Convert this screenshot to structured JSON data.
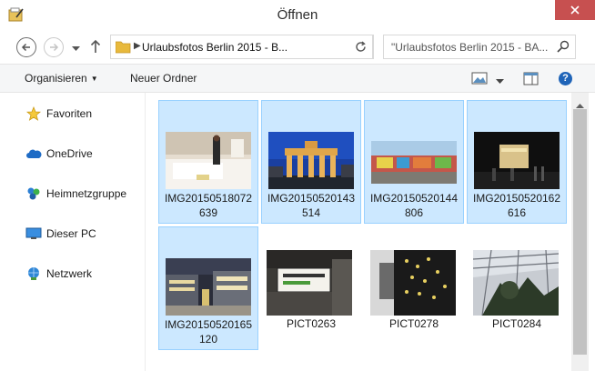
{
  "window": {
    "title": "Öffnen"
  },
  "address": {
    "path": "Urlaubsfotos Berlin 2015 - B...",
    "search_placeholder": "\"Urlaubsfotos Berlin 2015 - BA..."
  },
  "toolbar": {
    "organize_label": "Organisieren",
    "new_folder_label": "Neuer Ordner"
  },
  "sidebar": {
    "items": [
      {
        "label": "Favoriten",
        "icon": "star-icon"
      },
      {
        "label": "OneDrive",
        "icon": "cloud-icon"
      },
      {
        "label": "Heimnetzgruppe",
        "icon": "homegroup-icon"
      },
      {
        "label": "Dieser PC",
        "icon": "computer-icon"
      },
      {
        "label": "Netzwerk",
        "icon": "network-icon"
      }
    ]
  },
  "files": [
    {
      "name": "IMG20150518072639",
      "line1": "IMG20150518072",
      "line2": "639",
      "selected": true
    },
    {
      "name": "IMG20150520143514",
      "line1": "IMG20150520143",
      "line2": "514",
      "selected": true
    },
    {
      "name": "IMG20150520144806",
      "line1": "IMG20150520144",
      "line2": "806",
      "selected": true
    },
    {
      "name": "IMG20150520162616",
      "line1": "IMG20150520162",
      "line2": "616",
      "selected": true
    },
    {
      "name": "IMG20150520165120",
      "line1": "IMG20150520165",
      "line2": "120",
      "selected": true
    },
    {
      "name": "PICT0263",
      "line1": "PICT0263",
      "line2": "",
      "selected": false
    },
    {
      "name": "PICT0278",
      "line1": "PICT0278",
      "line2": "",
      "selected": false
    },
    {
      "name": "PICT0284",
      "line1": "PICT0284",
      "line2": "",
      "selected": false
    }
  ],
  "colors": {
    "selection_bg": "#cce8ff",
    "selection_border": "#99d1ff",
    "close_button": "#c75050"
  }
}
